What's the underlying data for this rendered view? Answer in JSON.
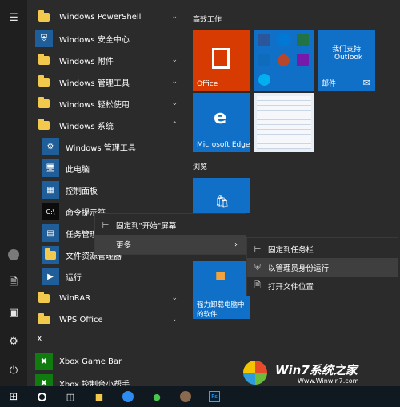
{
  "apps": {
    "powershell": "Windows PowerShell",
    "security": "Windows 安全中心",
    "accessories": "Windows 附件",
    "admin_tools": "Windows 管理工具",
    "ease": "Windows 轻松使用",
    "system": "Windows 系统",
    "sys_admin_tools": "Windows 管理工具",
    "this_pc": "此电脑",
    "control_panel": "控制面板",
    "cmd": "命令提示符",
    "task_manager": "任务管理器",
    "file_explorer": "文件资源管理器",
    "run": "运行",
    "winrar": "WinRAR",
    "wps": "WPS Office",
    "letter_x": "X",
    "xbox": "Xbox Game Bar",
    "xbox2": "Xbox 控制台小帮手"
  },
  "groups": {
    "work": "高效工作",
    "browse": "浏览"
  },
  "tiles": {
    "office": "Office",
    "outlook_line1": "我们支持",
    "outlook_line2": "Outlook",
    "mail": "邮件",
    "edge": "Microsoft Edge",
    "uninstall_line1": "强力卸载电脑中",
    "uninstall_line2": "的软件"
  },
  "context_menu": {
    "pin_start": "固定到\"开始\"屏幕",
    "more": "更多"
  },
  "submenu": {
    "pin_taskbar": "固定到任务栏",
    "run_admin": "以管理员身份运行",
    "open_location": "打开文件位置"
  },
  "watermark": {
    "brand": "Win7系统之家",
    "url": "Www.Winwin7.com"
  },
  "colors": {
    "accent_blue": "#1070c8",
    "office_orange": "#d83b01",
    "folder_yellow": "#f2c94c",
    "highlight": "#3f3f3f"
  }
}
